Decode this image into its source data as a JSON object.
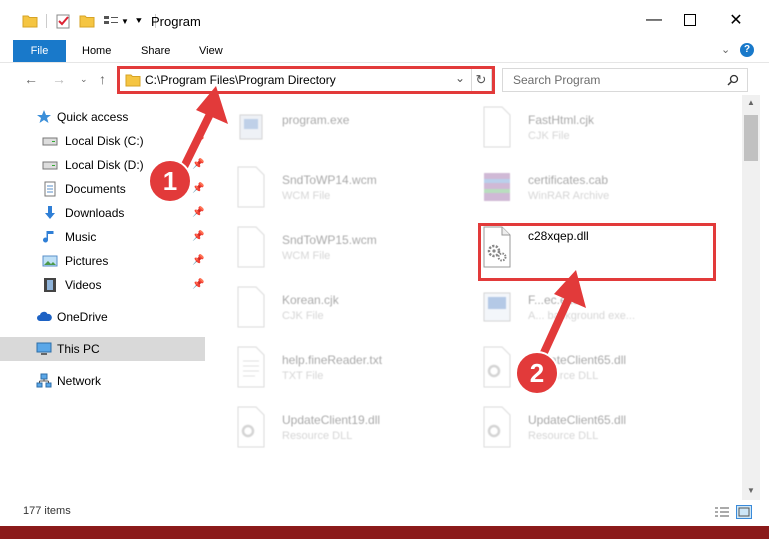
{
  "window": {
    "title": "Program"
  },
  "ribbon": {
    "tabs": [
      "File",
      "Home",
      "Share",
      "View"
    ]
  },
  "navigation": {
    "address": "C:\\Program Files\\Program Directory",
    "search_placeholder": "Search Program"
  },
  "sidebar": {
    "items": [
      {
        "label": "Quick access",
        "icon": "star-icon"
      },
      {
        "label": "Local Disk (C:)",
        "icon": "drive-icon"
      },
      {
        "label": "Local Disk (D:)",
        "icon": "drive-icon"
      },
      {
        "label": "Documents",
        "icon": "documents-icon"
      },
      {
        "label": "Downloads",
        "icon": "downloads-icon"
      },
      {
        "label": "Music",
        "icon": "music-icon"
      },
      {
        "label": "Pictures",
        "icon": "pictures-icon"
      },
      {
        "label": "Videos",
        "icon": "videos-icon"
      },
      {
        "label": "OneDrive",
        "icon": "cloud-icon"
      },
      {
        "label": "This PC",
        "icon": "computer-icon"
      },
      {
        "label": "Network",
        "icon": "network-icon"
      }
    ]
  },
  "files": [
    {
      "name": "program.exe",
      "type": ""
    },
    {
      "name": "FastHtml.cjk",
      "type": "CJK File"
    },
    {
      "name": "SndToWP14.wcm",
      "type": "WCM File"
    },
    {
      "name": "certificates.cab",
      "type": "WinRAR Archive"
    },
    {
      "name": "SndToWP15.wcm",
      "type": "WCM File"
    },
    {
      "name": "c28xqep.dll",
      "type": ""
    },
    {
      "name": "Korean.cjk",
      "type": "CJK File"
    },
    {
      "name": "F...ec.exe",
      "type": "A... background exe..."
    },
    {
      "name": "help.fineReader.txt",
      "type": "TXT File"
    },
    {
      "name": "UpdateClient65.dll",
      "type": "Resource DLL"
    },
    {
      "name": "UpdateClient19.dll",
      "type": "Resource DLL"
    },
    {
      "name": "UpdateClient65.dll",
      "type": "Resource DLL"
    }
  ],
  "status": {
    "item_count": "177 items"
  },
  "annotations": {
    "step1": "1",
    "step2": "2"
  },
  "colors": {
    "accent": "#1979ca",
    "marker": "#e23a3a"
  }
}
